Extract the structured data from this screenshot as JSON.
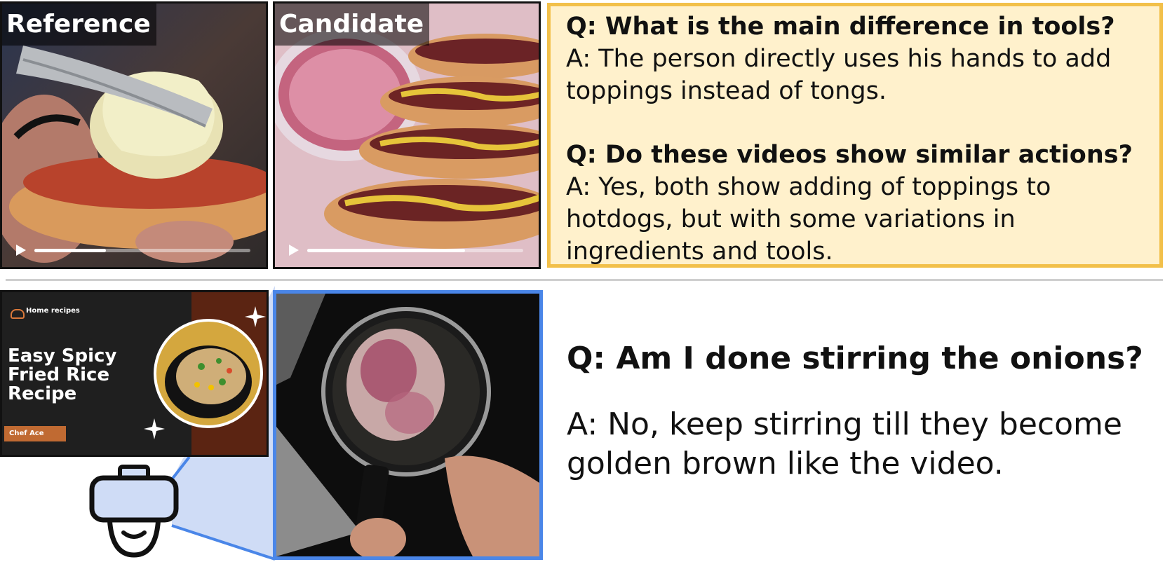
{
  "top": {
    "reference_label": "Reference",
    "candidate_label": "Candidate",
    "reference_progress": 0.33,
    "candidate_progress": 0.73,
    "qa": [
      {
        "q": "Q: What is the main difference in tools?",
        "a": "A: The person directly uses his hands to add toppings instead of tongs."
      },
      {
        "q": "Q: Do these videos show similar actions?",
        "a": "A: Yes, both show adding of toppings to hotdogs, but with some variations in ingredients and tools."
      }
    ]
  },
  "bottom": {
    "thumbnail": {
      "brand": "Home recipes",
      "title": "Easy Spicy Fried Rice Recipe",
      "chef": "Chef Ace"
    },
    "question": "Q: Am I done stirring the onions?",
    "answer": "A: No, keep stirring till they become golden brown like the video."
  },
  "colors": {
    "qa_background": "#fff1cc",
    "qa_border": "#f2c04a",
    "egocentric_frame": "#4a86e8",
    "headset_fill": "#cfdcf6"
  }
}
